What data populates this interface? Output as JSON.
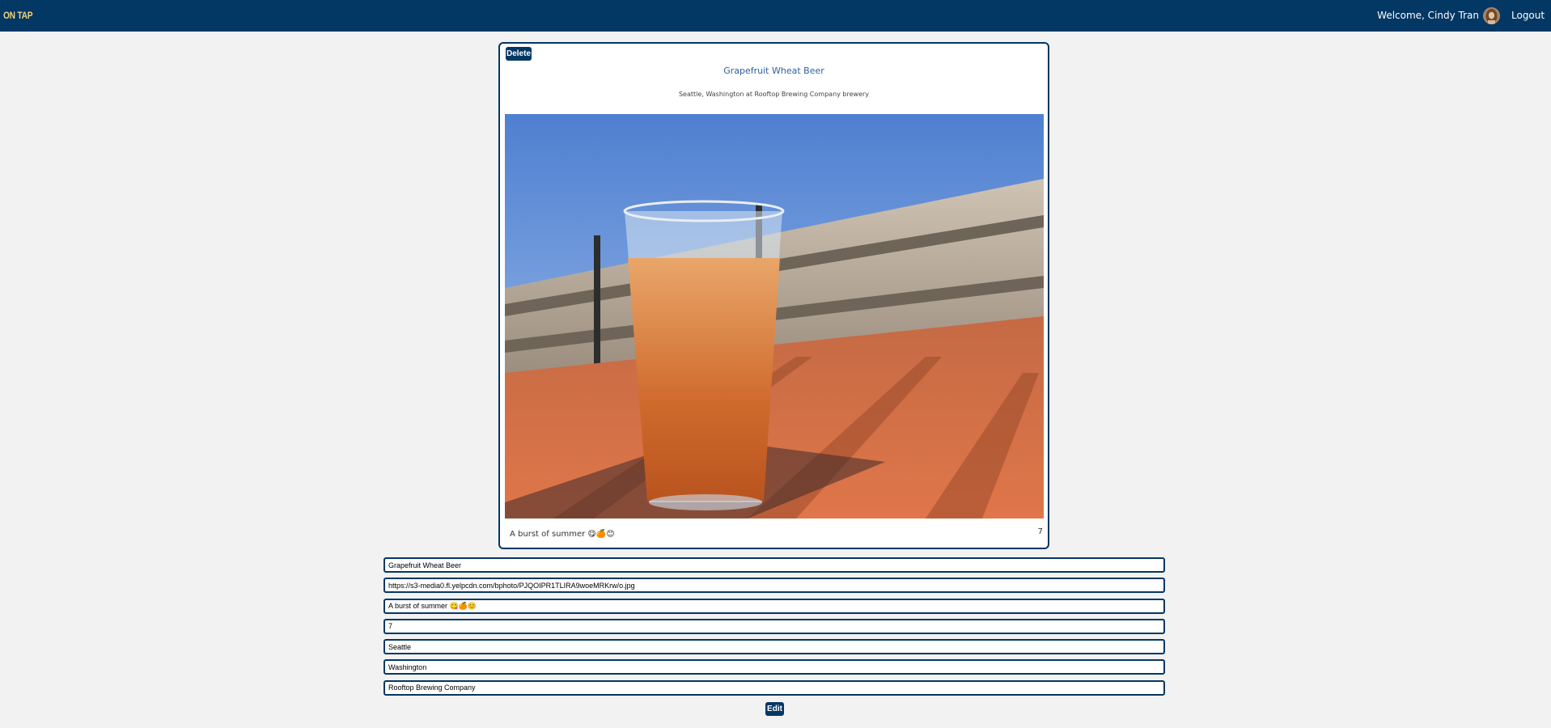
{
  "nav": {
    "logo": "ON TAP",
    "welcome": "Welcome, Cindy Tran",
    "logout": "Logout"
  },
  "post": {
    "delete_label": "Delete",
    "title": "Grapefruit Wheat Beer",
    "location": "Seattle, Washington at Rooftop Brewing Company brewery",
    "caption": "A burst of summer 😋🍊😊",
    "rating": "7"
  },
  "form": {
    "name": "Grapefruit Wheat Beer",
    "image_url": "https://s3-media0.fl.yelpcdn.com/bphoto/PJQOIPR1TLIRA9woeMRKrw/o.jpg",
    "caption": "A burst of summer 😋🍊😊",
    "rating": "7",
    "city": "Seattle",
    "state": "Washington",
    "brewery": "Rooftop Brewing Company",
    "edit_label": "Edit"
  },
  "colors": {
    "nav": "#033764",
    "logo": "#f1d27a",
    "title": "#2e5f9e",
    "background": "#f2f2f2"
  }
}
